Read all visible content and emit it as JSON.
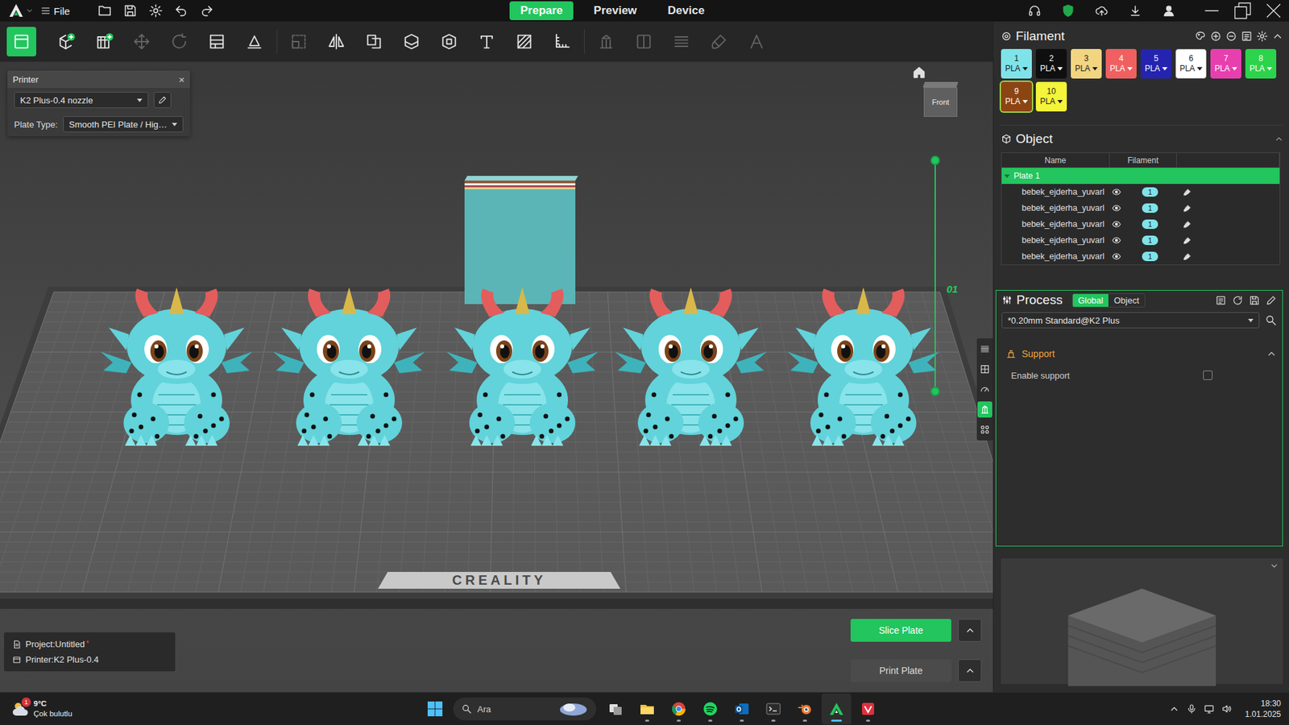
{
  "app": {
    "menu_label": "File"
  },
  "tabs": [
    {
      "label": "Prepare",
      "selected": true
    },
    {
      "label": "Preview",
      "selected": false
    },
    {
      "label": "Device",
      "selected": false
    }
  ],
  "toolbar": [
    {
      "kind": "plate",
      "group": 1,
      "selected": true,
      "disabled": false
    },
    {
      "kind": "add-object",
      "group": 1,
      "selected": false,
      "disabled": false
    },
    {
      "kind": "add-plate",
      "group": 1,
      "selected": false,
      "disabled": false
    },
    {
      "kind": "move",
      "group": 2,
      "selected": false,
      "disabled": true
    },
    {
      "kind": "rotate",
      "group": 2,
      "selected": false,
      "disabled": true
    },
    {
      "kind": "arrange",
      "group": 2,
      "selected": false,
      "disabled": false
    },
    {
      "kind": "orient",
      "group": 2,
      "selected": false,
      "disabled": false
    },
    {
      "kind": "scale",
      "group": 3,
      "selected": false,
      "disabled": true
    },
    {
      "kind": "mirror",
      "group": 3,
      "selected": false,
      "disabled": false
    },
    {
      "kind": "split",
      "group": 3,
      "selected": false,
      "disabled": false
    },
    {
      "kind": "cut",
      "group": 3,
      "selected": false,
      "disabled": false
    },
    {
      "kind": "hollow",
      "group": 3,
      "selected": false,
      "disabled": false
    },
    {
      "kind": "text",
      "group": 3,
      "selected": false,
      "disabled": false
    },
    {
      "kind": "slash",
      "group": 3,
      "selected": false,
      "disabled": false
    },
    {
      "kind": "measure",
      "group": 3,
      "selected": false,
      "disabled": false
    },
    {
      "kind": "support",
      "group": 4,
      "selected": false,
      "disabled": true
    },
    {
      "kind": "seam",
      "group": 4,
      "selected": false,
      "disabled": true
    },
    {
      "kind": "layers",
      "group": 4,
      "selected": false,
      "disabled": true
    },
    {
      "kind": "paint",
      "group": 4,
      "selected": false,
      "disabled": true
    },
    {
      "kind": "font",
      "group": 4,
      "selected": false,
      "disabled": true
    }
  ],
  "printer_panel": {
    "title": "Printer",
    "close": "×",
    "printer": "K2 Plus-0.4 nozzle",
    "plate_type_label": "Plate Type:",
    "plate_type": "Smooth PEI Plate / Hig…"
  },
  "viewport": {
    "view_cube": "Front",
    "plate_logo": "CREALITY",
    "plate_number": "01",
    "layer_slider": {
      "upper": 1,
      "lower": 0
    },
    "side_tools": [
      {
        "kind": "layers",
        "selected": false
      },
      {
        "kind": "grid",
        "selected": false
      },
      {
        "kind": "gauge",
        "selected": false
      },
      {
        "kind": "support",
        "selected": true
      },
      {
        "kind": "nodes",
        "selected": false
      }
    ]
  },
  "project_info": {
    "project": "Project:Untitled",
    "modified": "*",
    "printer": "Printer:K2 Plus-0.4"
  },
  "actions": [
    {
      "label": "Slice Plate",
      "disabled": false
    },
    {
      "label": "Print Plate",
      "disabled": true
    }
  ],
  "filament": {
    "title": "Filament",
    "slots": [
      {
        "number": "1",
        "type": "PLA",
        "color": "#7fe3ea",
        "selected": false
      },
      {
        "number": "2",
        "type": "PLA",
        "color": "#0f0f0f",
        "selected": false
      },
      {
        "number": "3",
        "type": "PLA",
        "color": "#f2d580",
        "selected": false
      },
      {
        "number": "4",
        "type": "PLA",
        "color": "#f06060",
        "selected": false
      },
      {
        "number": "5",
        "type": "PLA",
        "color": "#2424b0",
        "selected": false
      },
      {
        "number": "6",
        "type": "PLA",
        "color": "#ffffff",
        "selected": false
      },
      {
        "number": "7",
        "type": "PLA",
        "color": "#e83fae",
        "selected": false
      },
      {
        "number": "8",
        "type": "PLA",
        "color": "#2bd44b",
        "selected": false
      },
      {
        "number": "9",
        "type": "PLA",
        "color": "#8b4513",
        "selected": true
      },
      {
        "number": "10",
        "type": "PLA",
        "color": "#f4f43a",
        "selected": false
      }
    ]
  },
  "objects": {
    "title": "Object",
    "columns": [
      "Name",
      "Filament"
    ],
    "plate": {
      "label": "Plate 1",
      "selected": true,
      "expanded": true
    },
    "rows": [
      {
        "name": "bebek_ejderha_yuvarl",
        "visible": true,
        "filament": "1"
      },
      {
        "name": "bebek_ejderha_yuvarl",
        "visible": true,
        "filament": "1"
      },
      {
        "name": "bebek_ejderha_yuvarl",
        "visible": true,
        "filament": "1"
      },
      {
        "name": "bebek_ejderha_yuvarl",
        "visible": true,
        "filament": "1"
      },
      {
        "name": "bebek_ejderha_yuvarl",
        "visible": true,
        "filament": "1"
      }
    ]
  },
  "process": {
    "title": "Process",
    "modes": [
      {
        "label": "Global",
        "selected": true
      },
      {
        "label": "Object",
        "selected": false
      }
    ],
    "preset": "*0.20mm Standard@K2 Plus",
    "section": {
      "title": "Support",
      "expanded": true
    },
    "options": [
      {
        "label": "Enable support",
        "checked": false
      }
    ]
  },
  "taskbar": {
    "weather": {
      "temperature": "9°C",
      "condition": "Çok bulutlu",
      "badge": "1"
    },
    "search": "Ara",
    "apps": [
      {
        "kind": "task-view",
        "running": false,
        "active": false
      },
      {
        "kind": "explorer",
        "running": true,
        "active": false
      },
      {
        "kind": "chrome",
        "running": true,
        "active": false
      },
      {
        "kind": "spotify",
        "running": true,
        "active": false
      },
      {
        "kind": "outlook",
        "running": true,
        "active": false
      },
      {
        "kind": "terminal",
        "running": true,
        "active": false
      },
      {
        "kind": "blender",
        "running": true,
        "active": false
      },
      {
        "kind": "creality",
        "running": true,
        "active": true
      },
      {
        "kind": "pdf",
        "running": true,
        "active": false
      }
    ],
    "time": "18:30",
    "date": "1.01.2025"
  }
}
